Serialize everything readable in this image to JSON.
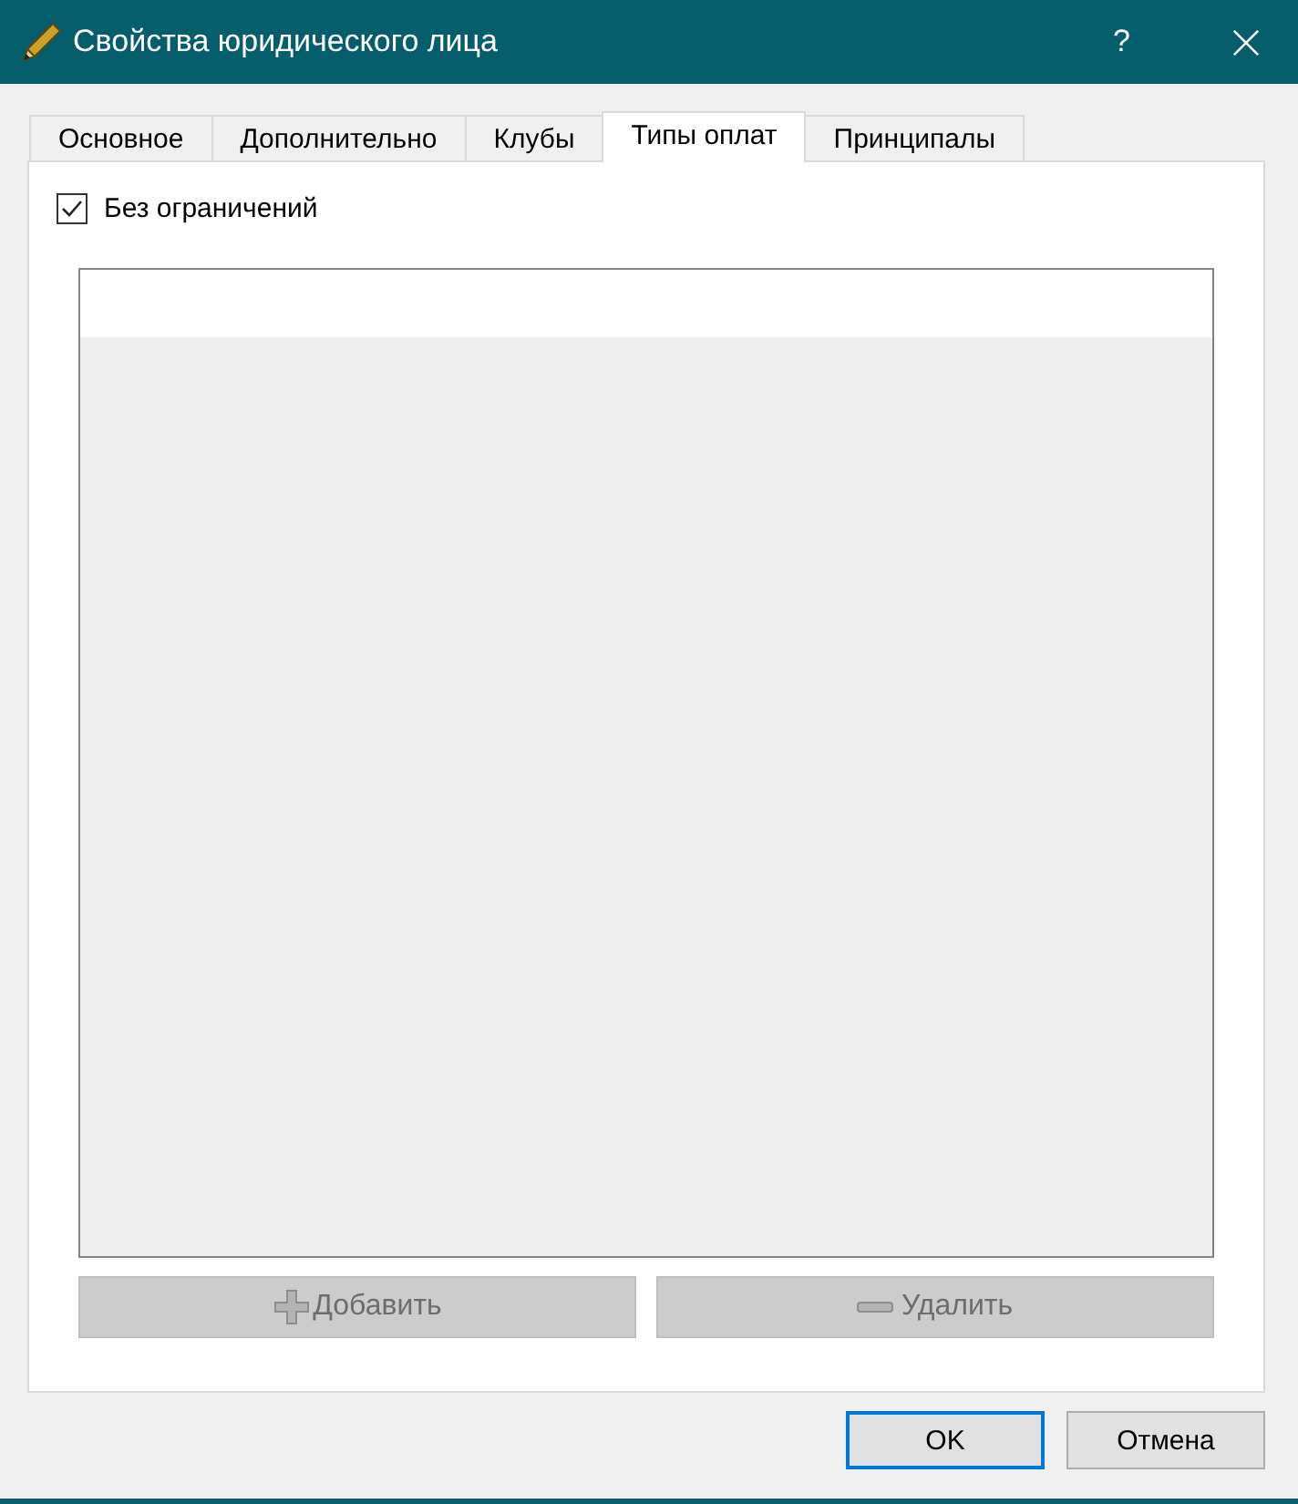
{
  "window": {
    "title": "Свойства юридического лица",
    "help": "?"
  },
  "tabs": [
    {
      "label": "Основное",
      "selected": false
    },
    {
      "label": "Дополнительно",
      "selected": false
    },
    {
      "label": "Клубы",
      "selected": false
    },
    {
      "label": "Типы оплат",
      "selected": true
    },
    {
      "label": "Принципалы",
      "selected": false
    }
  ],
  "checkbox": {
    "label": "Без ограничений",
    "checked": true
  },
  "list_buttons": [
    {
      "kind": "add",
      "label": "Добавить",
      "disabled": true
    },
    {
      "kind": "remove",
      "label": "Удалить",
      "disabled": true
    }
  ],
  "dialog_buttons": [
    {
      "label": "OK",
      "default": true
    },
    {
      "label": "Отмена",
      "default": false
    }
  ]
}
